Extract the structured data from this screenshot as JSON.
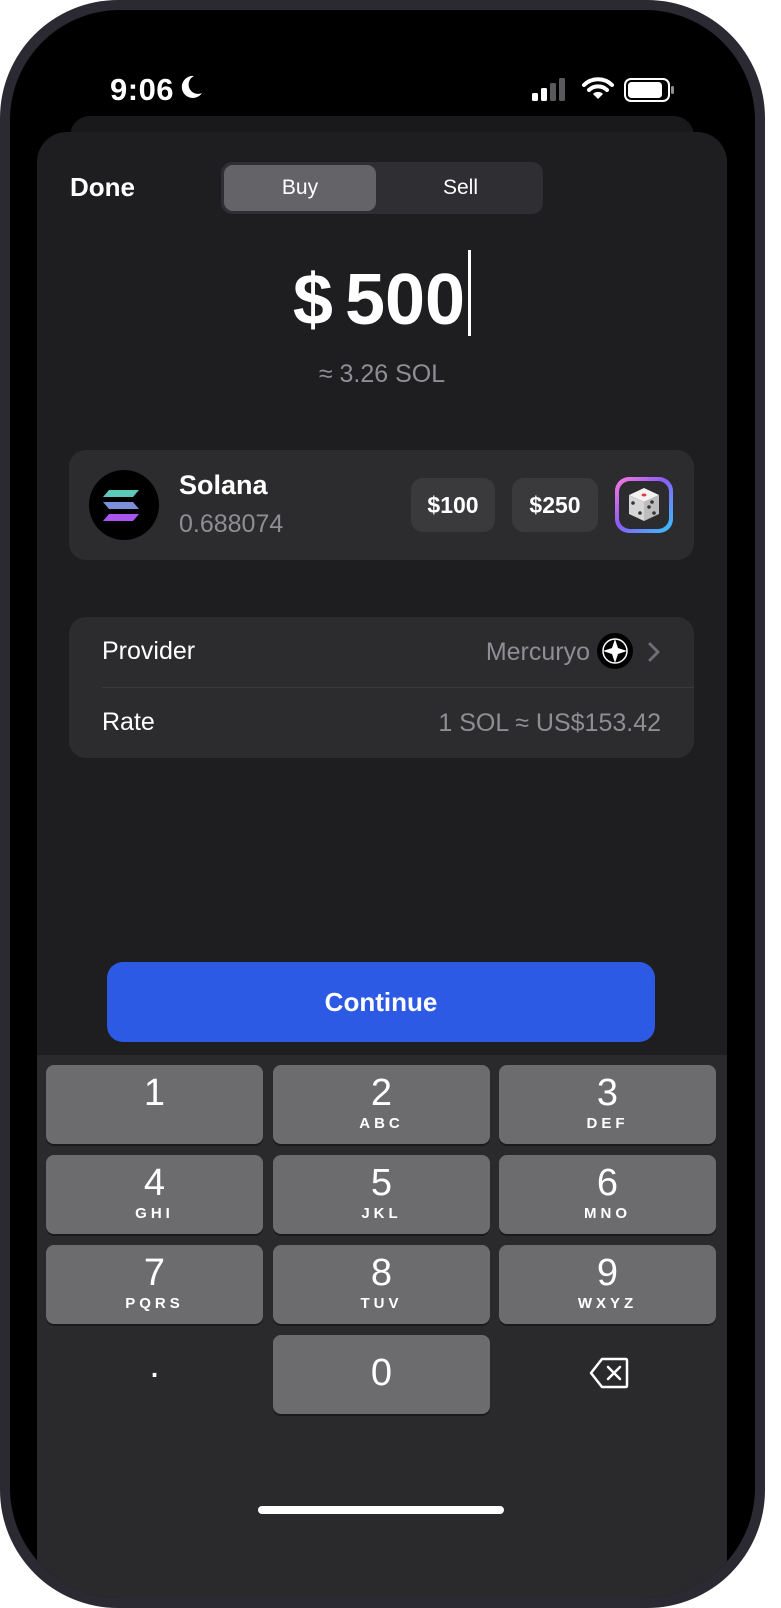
{
  "status_bar": {
    "time": "9:06"
  },
  "header": {
    "done_label": "Done",
    "tabs": [
      {
        "label": "Buy",
        "selected": true
      },
      {
        "label": "Sell",
        "selected": false
      }
    ]
  },
  "amount": {
    "currency": "$",
    "value": "500",
    "approx": "≈ 3.26 SOL"
  },
  "token": {
    "name": "Solana",
    "balance": "0.688074",
    "quick_amounts": [
      "$100",
      "$250"
    ],
    "random_icon": "dice-icon"
  },
  "details": {
    "provider_label": "Provider",
    "provider_value": "Mercuryo",
    "rate_label": "Rate",
    "rate_value": "1 SOL ≈ US$153.42"
  },
  "continue_label": "Continue",
  "keypad": {
    "keys": [
      {
        "num": "1",
        "letters": ""
      },
      {
        "num": "2",
        "letters": "ABC"
      },
      {
        "num": "3",
        "letters": "DEF"
      },
      {
        "num": "4",
        "letters": "GHI"
      },
      {
        "num": "5",
        "letters": "JKL"
      },
      {
        "num": "6",
        "letters": "MNO"
      },
      {
        "num": "7",
        "letters": "PQRS"
      },
      {
        "num": "8",
        "letters": "TUV"
      },
      {
        "num": "9",
        "letters": "WXYZ"
      }
    ],
    "decimal": ".",
    "zero": "0"
  },
  "colors": {
    "accent": "#2c5ae5",
    "background": "#1e1e20",
    "card": "#2c2c2e",
    "secondary_text": "#8e8e93"
  }
}
